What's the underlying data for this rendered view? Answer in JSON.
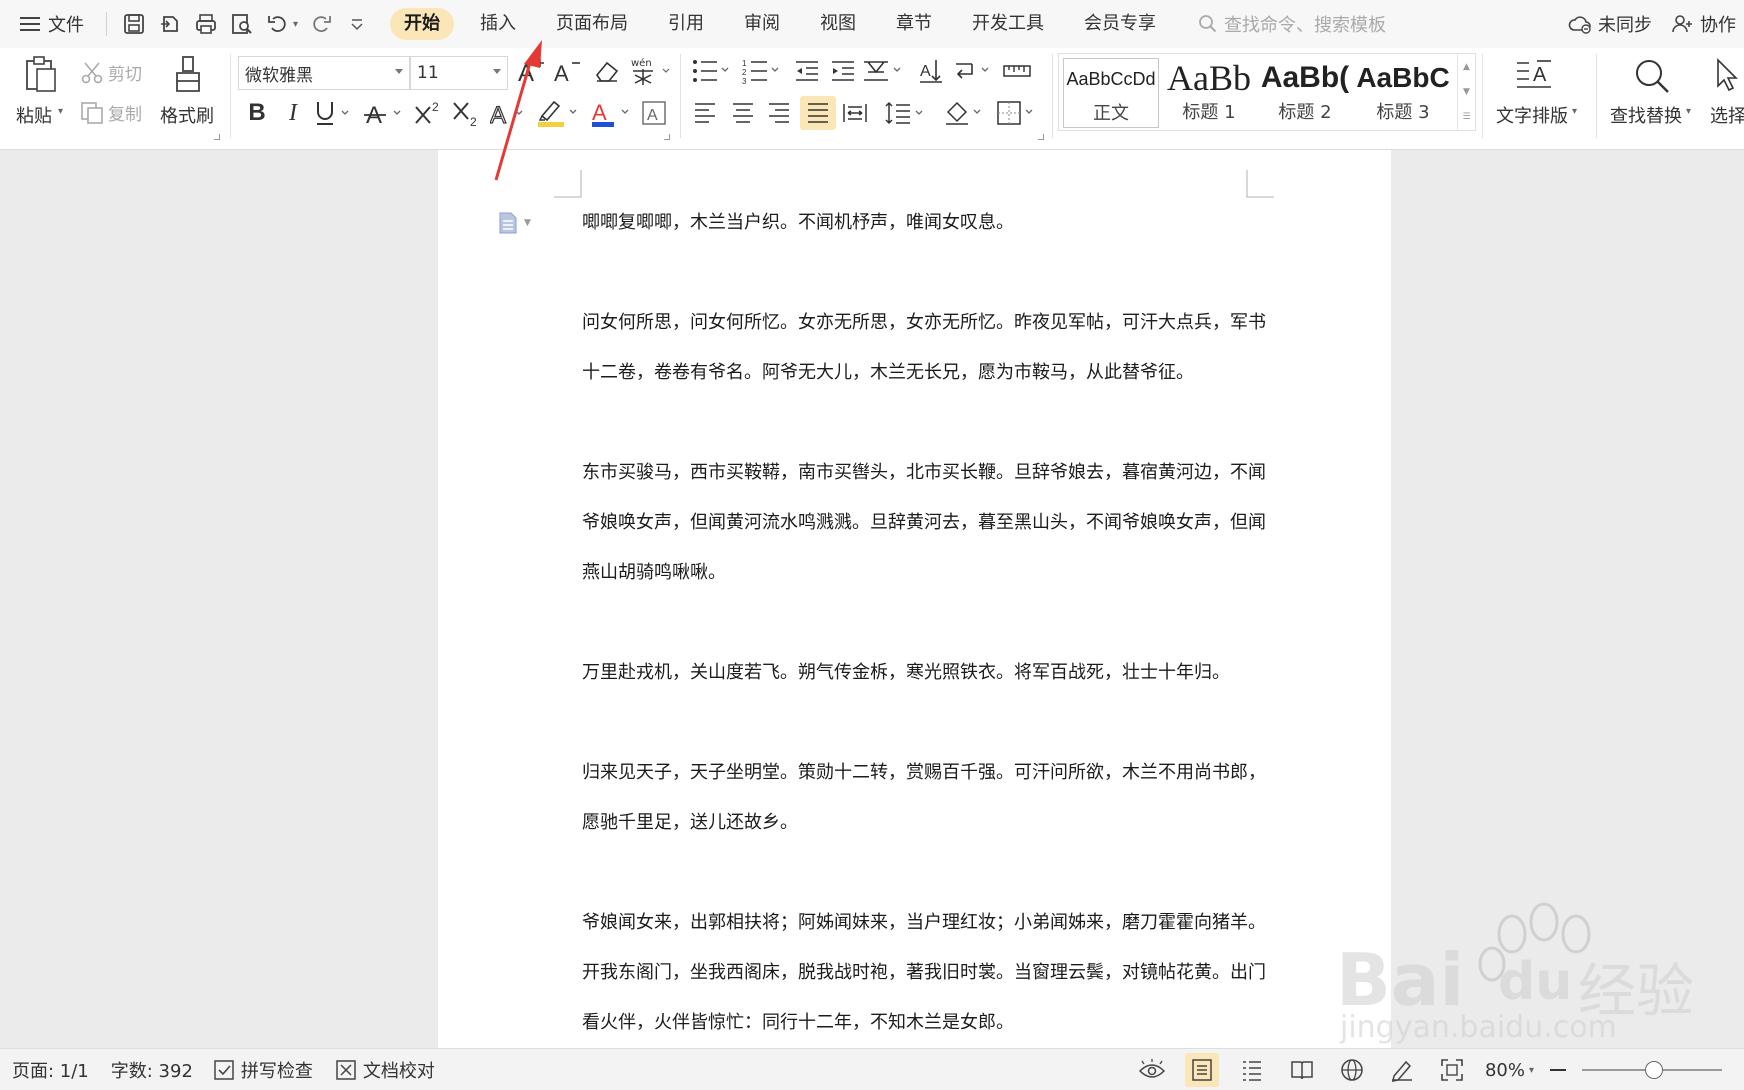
{
  "menu": {
    "file_label": "文件",
    "tabs": [
      {
        "label": "开始",
        "active": true
      },
      {
        "label": "插入"
      },
      {
        "label": "页面布局"
      },
      {
        "label": "引用"
      },
      {
        "label": "审阅"
      },
      {
        "label": "视图"
      },
      {
        "label": "章节"
      },
      {
        "label": "开发工具"
      },
      {
        "label": "会员专享"
      }
    ],
    "search_placeholder": "查找命令、搜索模板",
    "sync_label": "未同步",
    "collab_label": "协作"
  },
  "ribbon": {
    "paste_label": "粘贴",
    "cut_label": "剪切",
    "copy_label": "复制",
    "format_painter_label": "格式刷",
    "font_name": "微软雅黑",
    "font_size": "11",
    "styles": [
      {
        "sample": "AaBbCcDd",
        "caption": "正文"
      },
      {
        "sample": "AaBb",
        "caption": "标题 1"
      },
      {
        "sample": "AaBb(",
        "caption": "标题 2"
      },
      {
        "sample": "AaBbC",
        "caption": "标题 3"
      }
    ],
    "text_layout_label": "文字排版",
    "find_replace_label": "查找替换",
    "select_label": "选择"
  },
  "document": {
    "lines": [
      "唧唧复唧唧，木兰当户织。不闻机杼声，唯闻女叹息。",
      "问女何所思，问女何所忆。女亦无所思，女亦无所忆。昨夜见军帖，可汗大点兵，军书",
      "十二卷，卷卷有爷名。阿爷无大儿，木兰无长兄，愿为市鞍马，从此替爷征。",
      "东市买骏马，西市买鞍鞯，南市买辔头，北市买长鞭。旦辞爷娘去，暮宿黄河边，不闻",
      "爷娘唤女声，但闻黄河流水鸣溅溅。旦辞黄河去，暮至黑山头，不闻爷娘唤女声，但闻",
      "燕山胡骑鸣啾啾。",
      "万里赴戎机，关山度若飞。朔气传金柝，寒光照铁衣。将军百战死，壮士十年归。",
      "归来见天子，天子坐明堂。策勋十二转，赏赐百千强。可汗问所欲，木兰不用尚书郎，",
      "愿驰千里足，送儿还故乡。",
      "爷娘闻女来，出郭相扶将；阿姊闻妹来，当户理红妆；小弟闻姊来，磨刀霍霍向猪羊。",
      "开我东阁门，坐我西阁床，脱我战时袍，著我旧时裳。当窗理云鬓，对镜帖花黄。出门",
      "看火伴，火伴皆惊忙：同行十二年，不知木兰是女郎。"
    ]
  },
  "status": {
    "page": "页面: 1/1",
    "word_count": "字数: 392",
    "spell_check": "拼写检查",
    "doc_proof": "文档校对",
    "zoom": "80%",
    "zoom_fraction": 0.8
  },
  "watermark": {
    "brand": "Bai",
    "brand2": "du",
    "cn": "经验",
    "url": "jingyan.baidu.com"
  },
  "colors": {
    "active_tab": "#fbe6b8",
    "annotation_arrow": "#e53935",
    "highlight_yellow": "#f4d03f",
    "font_color_red": "#e53935",
    "font_color_blue": "#1e4fd6"
  }
}
